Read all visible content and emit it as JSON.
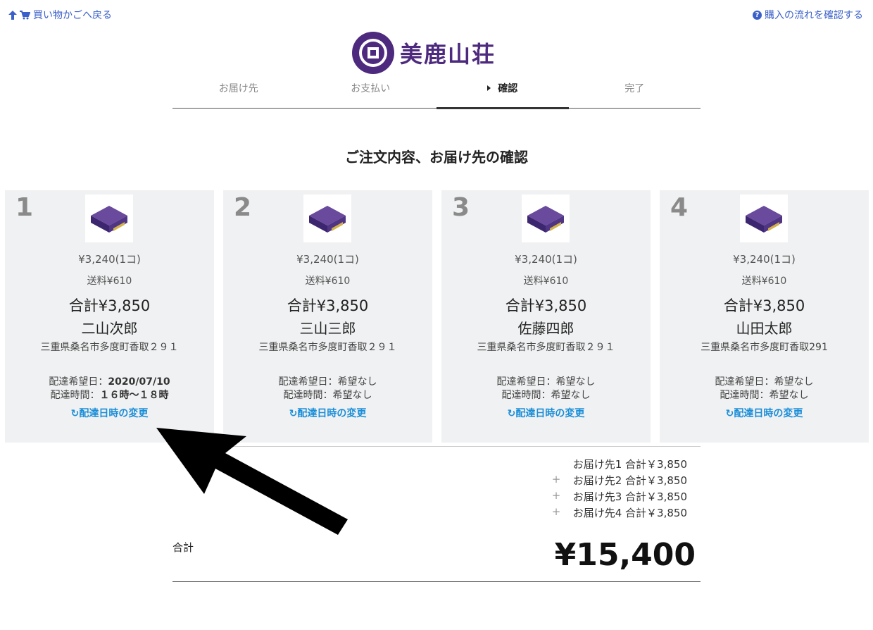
{
  "top": {
    "back_label": "買い物かごへ戻る",
    "help_label": "購入の流れを確認する"
  },
  "logo": {
    "text": "美鹿山荘"
  },
  "steps": [
    {
      "label": "お届け先",
      "active": false
    },
    {
      "label": "お支払い",
      "active": false
    },
    {
      "label": "確認",
      "active": true
    },
    {
      "label": "完了",
      "active": false
    }
  ],
  "heading": "ご注文内容、お届け先の確認",
  "cards": [
    {
      "num": "1",
      "price": "¥3,240(1コ)",
      "shipping": "送料¥610",
      "total": "合計¥3,850",
      "name": "二山次郎",
      "address": "三重県桑名市多度町香取２９１",
      "date_label": "配達希望日：",
      "date_value": "2020/07/10",
      "time_label": "配達時間：",
      "time_value": "１６時～１８時",
      "change_label": "配達日時の変更"
    },
    {
      "num": "2",
      "price": "¥3,240(1コ)",
      "shipping": "送料¥610",
      "total": "合計¥3,850",
      "name": "三山三郎",
      "address": "三重県桑名市多度町香取２９１",
      "date_label": "配達希望日：",
      "date_value": "希望なし",
      "time_label": "配達時間：",
      "time_value": "希望なし",
      "change_label": "配達日時の変更"
    },
    {
      "num": "3",
      "price": "¥3,240(1コ)",
      "shipping": "送料¥610",
      "total": "合計¥3,850",
      "name": "佐藤四郎",
      "address": "三重県桑名市多度町香取２９１",
      "date_label": "配達希望日：",
      "date_value": "希望なし",
      "time_label": "配達時間：",
      "time_value": "希望なし",
      "change_label": "配達日時の変更"
    },
    {
      "num": "4",
      "price": "¥3,240(1コ)",
      "shipping": "送料¥610",
      "total": "合計¥3,850",
      "name": "山田太郎",
      "address": "三重県桑名市多度町香取291",
      "date_label": "配達希望日：",
      "date_value": "希望なし",
      "time_label": "配達時間：",
      "time_value": "希望なし",
      "change_label": "配達日時の変更"
    }
  ],
  "summary": [
    {
      "plus": "",
      "text": "お届け先1 合計￥3,850"
    },
    {
      "plus": "+",
      "text": "お届け先2 合計￥3,850"
    },
    {
      "plus": "+",
      "text": "お届け先3 合計￥3,850"
    },
    {
      "plus": "+",
      "text": "お届け先4 合計￥3,850"
    }
  ],
  "grand_total": {
    "label": "合計",
    "value": "¥15,400"
  },
  "colors": {
    "link": "#3a5fc8",
    "accent_blue": "#1a8ed8",
    "logo_purple": "#4d2a7e",
    "card_bg": "#f0f1f2"
  },
  "icons": {
    "back": "arrow-up-icon",
    "cart": "cart-icon",
    "help": "question-circle-icon",
    "change": "rotate-icon"
  }
}
